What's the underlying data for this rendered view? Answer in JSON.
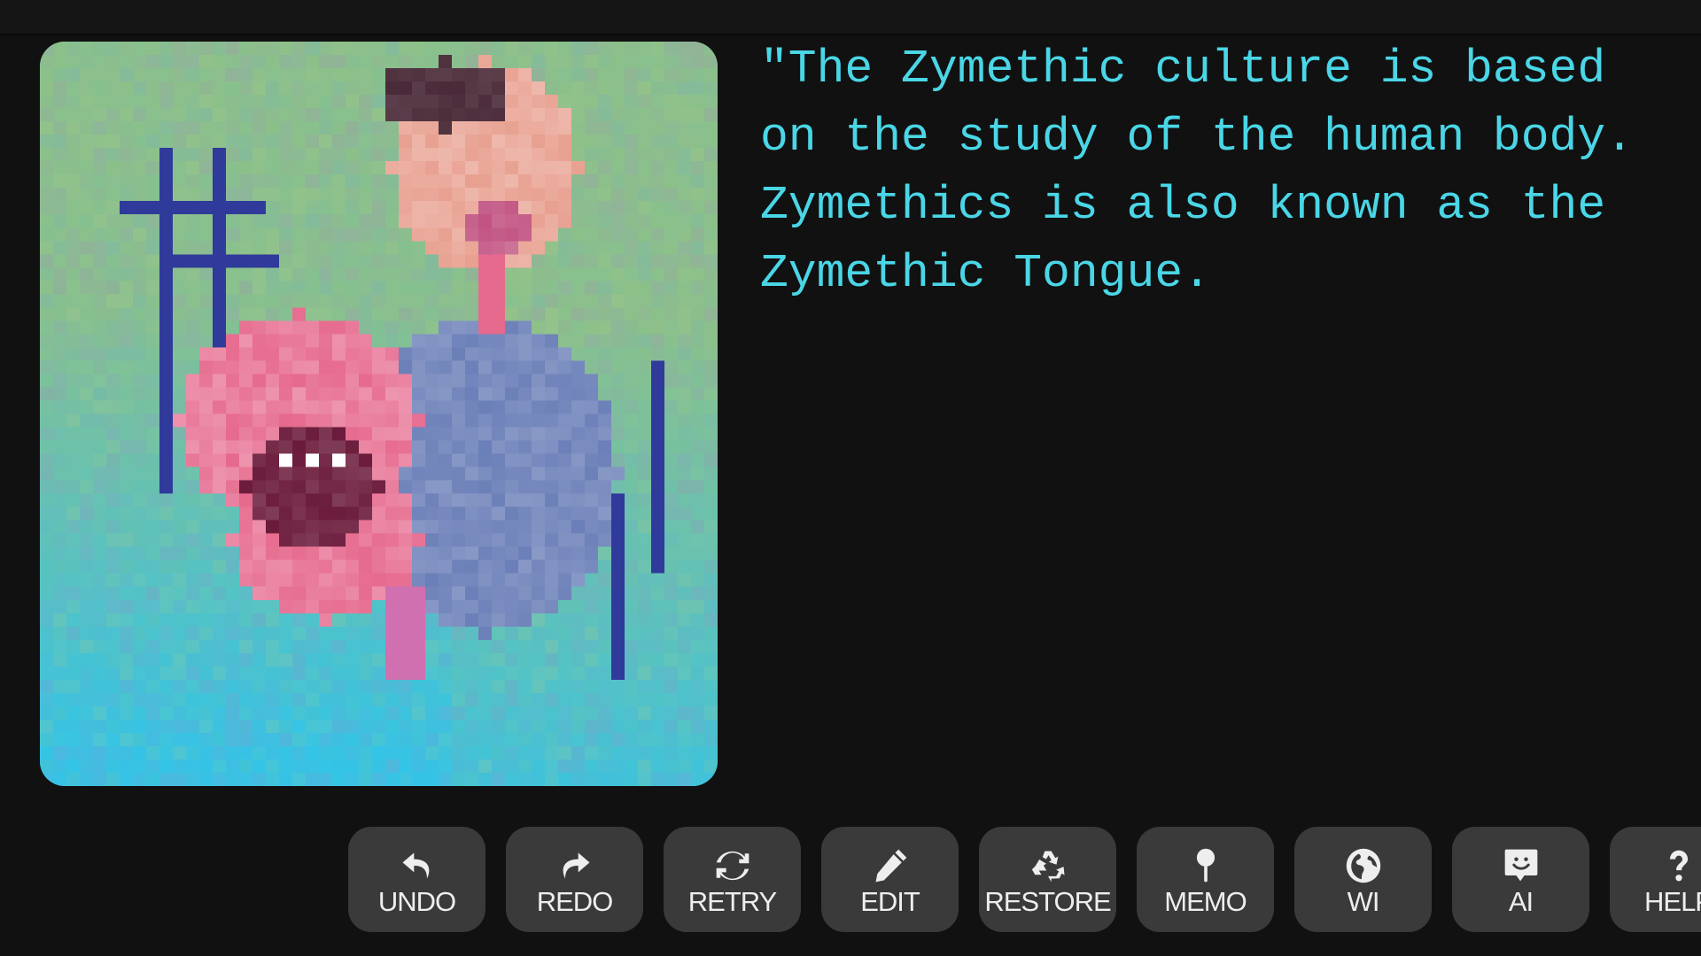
{
  "story": {
    "text": "\"The Zymethic culture is based\non the study of the human body.\nZymethics is also known as the\nZymethic Tongue."
  },
  "illustration": {
    "description": "pixel-art image of a man with an open mouth and tongue, beside a giant open pink mouth, over a green-to-cyan textured background",
    "palette": {
      "bg_top": "#8cc08a",
      "bg_bottom": "#33c4e6",
      "skin": "#e8a090",
      "lips": "#e66a8e",
      "shirt": "#6b7fb8",
      "outline": "#2f3a9a",
      "hair": "#4a2a38"
    }
  },
  "toolbar": {
    "buttons": [
      {
        "id": "undo",
        "label": "UNDO",
        "icon": "undo-arrow-icon"
      },
      {
        "id": "redo",
        "label": "REDO",
        "icon": "redo-arrow-icon"
      },
      {
        "id": "retry",
        "label": "RETRY",
        "icon": "refresh-icon"
      },
      {
        "id": "edit",
        "label": "EDIT",
        "icon": "pencil-icon"
      },
      {
        "id": "restore",
        "label": "RESTORE",
        "icon": "recycle-icon"
      },
      {
        "id": "memo",
        "label": "MEMO",
        "icon": "pushpin-icon"
      },
      {
        "id": "wi",
        "label": "WI",
        "icon": "globe-icon"
      },
      {
        "id": "ai",
        "label": "AI",
        "icon": "smiley-chat-icon"
      },
      {
        "id": "help",
        "label": "HELP",
        "icon": "question-icon"
      }
    ]
  }
}
